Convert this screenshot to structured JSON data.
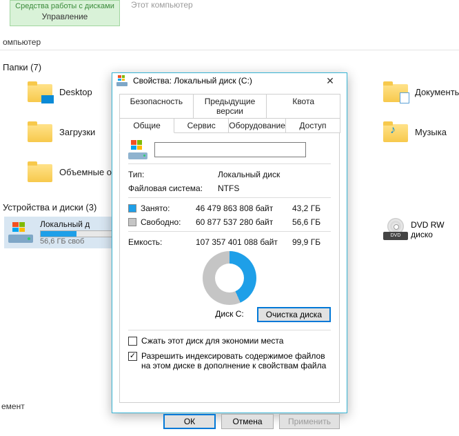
{
  "ribbon": {
    "context_title": "Средства работы с дисками",
    "active_tab": "Управление",
    "right_label": "Этот компьютер"
  },
  "breadcrumb": "омпьютер",
  "sections": {
    "folders": {
      "title": "Папки",
      "count": 7
    },
    "devices": {
      "title": "Устройства и диски",
      "count": 3
    }
  },
  "folders": {
    "desktop": "Desktop",
    "documents": "Документы",
    "downloads": "Загрузки",
    "music": "Музыка",
    "volume": "Объемные о"
  },
  "drives": {
    "c": {
      "title": "Локальный д",
      "subtitle": "56,6 ГБ своб"
    },
    "dvd": {
      "title": "DVD RW диско",
      "badge": "DVD"
    }
  },
  "footer": "емент",
  "dialog": {
    "title": "Свойства: Локальный диск (C:)",
    "tabs": {
      "security": "Безопасность",
      "prev": "Предыдущие версии",
      "quota": "Квота",
      "general": "Общие",
      "service": "Сервис",
      "hardware": "Оборудование",
      "access": "Доступ"
    },
    "name_value": "",
    "labels": {
      "type": "Тип:",
      "fs": "Файловая система:",
      "used": "Занято:",
      "free": "Свободно:",
      "capacity": "Емкость:",
      "disk_caption": "Диск C:"
    },
    "values": {
      "type": "Локальный диск",
      "fs": "NTFS",
      "used_bytes": "46 479 863 808 байт",
      "used_gb": "43,2 ГБ",
      "free_bytes": "60 877 537 280 байт",
      "free_gb": "56,6 ГБ",
      "cap_bytes": "107 357 401 088 байт",
      "cap_gb": "99,9 ГБ"
    },
    "clean_button": "Очистка диска",
    "compress_label": "Сжать этот диск для экономии места",
    "index_label": "Разрешить индексировать содержимое файлов на этом диске в дополнение к свойствам файла",
    "buttons": {
      "ok": "ОК",
      "cancel": "Отмена",
      "apply": "Применить"
    }
  },
  "chart_data": {
    "type": "pie",
    "title": "Диск C:",
    "series": [
      {
        "name": "Занято",
        "value_bytes": 46479863808,
        "value_gb": 43.2,
        "color": "#1e9fe8"
      },
      {
        "name": "Свободно",
        "value_bytes": 60877537280,
        "value_gb": 56.6,
        "color": "#c5c5c5"
      }
    ],
    "total": {
      "name": "Емкость",
      "value_bytes": 107357401088,
      "value_gb": 99.9
    }
  }
}
